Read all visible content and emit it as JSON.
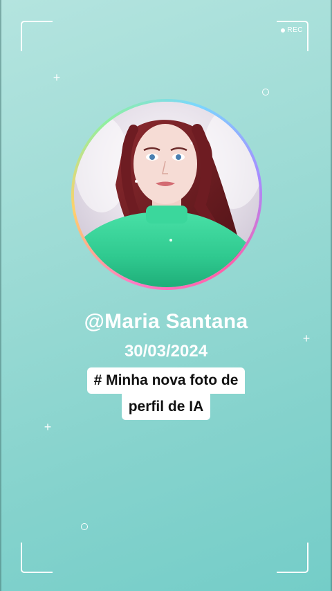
{
  "recording": {
    "label": "REC"
  },
  "profile": {
    "handle": "@Maria Santana",
    "date": "30/03/2024",
    "caption_line1": "# Minha nova foto de",
    "caption_line2": "perfil de IA"
  },
  "icons": [
    "rec-dot-icon",
    "sparkle-icon",
    "ring-icon"
  ],
  "colors": {
    "background_top": "#b4e4df",
    "background_bottom": "#74cdc8",
    "text": "#ffffff",
    "caption_bg": "#ffffff",
    "caption_text": "#111111",
    "avatar_ring_pink": "#ff5fa8",
    "avatar_ring_purple": "#a78bff",
    "shirt_green": "#2fcf94",
    "hair": "#7a1f24"
  }
}
